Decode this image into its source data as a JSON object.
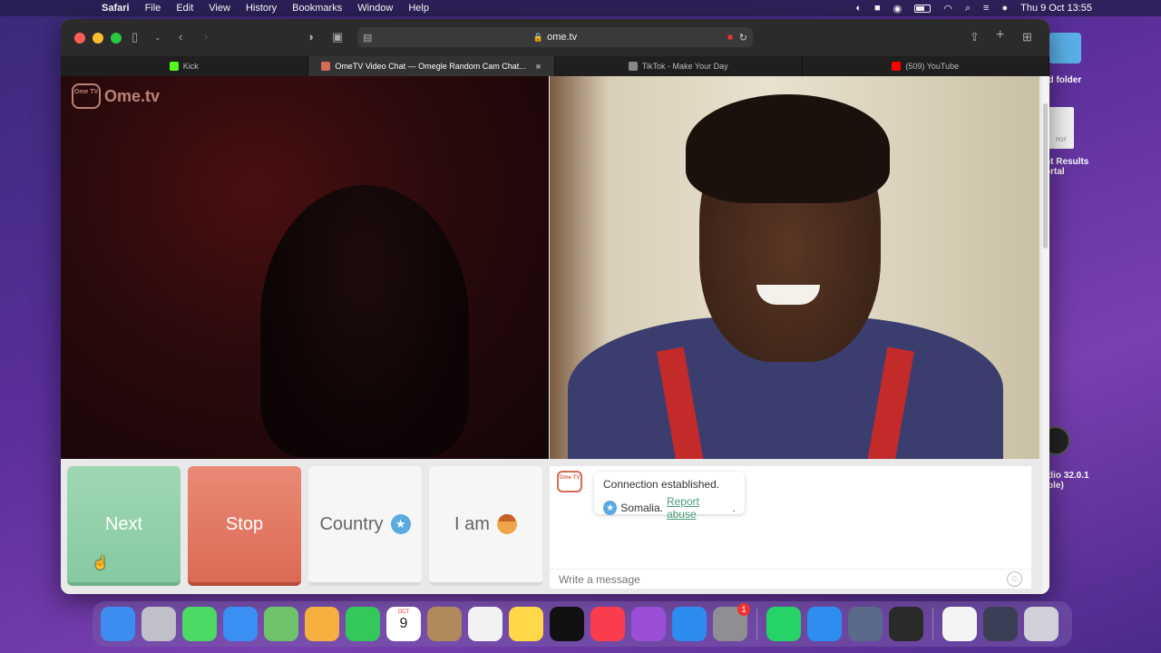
{
  "menubar": {
    "app": "Safari",
    "items": [
      "File",
      "Edit",
      "View",
      "History",
      "Bookmarks",
      "Window",
      "Help"
    ],
    "clock": "Thu 9 Oct  13:55"
  },
  "desktop": {
    "folder_label": "ed folder",
    "pdf_label": "nt Results\nortal",
    "obs_label": "dio 32.0.1\nple)"
  },
  "browser": {
    "url": "ome.tv",
    "tabs": [
      {
        "title": "Kick",
        "color": "#53fc18"
      },
      {
        "title": "OmeTV Video Chat — Omegle Random Cam Chat...",
        "color": "#d36b55"
      },
      {
        "title": "TikTok - Make Your Day",
        "color": "#888888"
      },
      {
        "title": "(509) YouTube",
        "color": "#ff0000"
      }
    ]
  },
  "ometv": {
    "logo_text": "Ome.tv",
    "logo_tv": "Ome TV",
    "buttons": {
      "next": "Next",
      "stop": "Stop",
      "country": "Country",
      "iam": "I am"
    },
    "chat": {
      "line1": "Connection established.",
      "country": "Somalia.",
      "report": "Report abuse",
      "report_suffix": ".",
      "input_placeholder": "Write a message"
    }
  },
  "dock": {
    "calendar_month": "OCT",
    "calendar_day": "9",
    "settings_badge": "1",
    "apps": [
      {
        "name": "finder",
        "color": "#3d8cf0"
      },
      {
        "name": "launchpad",
        "color": "#c0c0c8"
      },
      {
        "name": "messages",
        "color": "#4cd964"
      },
      {
        "name": "mail",
        "color": "#3a8ff5"
      },
      {
        "name": "maps",
        "color": "#6fc36b"
      },
      {
        "name": "photos",
        "color": "#f5b040"
      },
      {
        "name": "facetime",
        "color": "#34c759"
      },
      {
        "name": "calendar",
        "color": "#ffffff"
      },
      {
        "name": "contacts",
        "color": "#b08a5a"
      },
      {
        "name": "reminders",
        "color": "#f2f2f2"
      },
      {
        "name": "notes",
        "color": "#ffd84a"
      },
      {
        "name": "tv",
        "color": "#111111"
      },
      {
        "name": "music",
        "color": "#fa3c4c"
      },
      {
        "name": "podcasts",
        "color": "#9b4ed8"
      },
      {
        "name": "app-store",
        "color": "#2d8cf0"
      },
      {
        "name": "system-settings",
        "color": "#8e8e93"
      },
      {
        "name": "whatsapp",
        "color": "#25d366"
      },
      {
        "name": "safari",
        "color": "#2e8ef0"
      },
      {
        "name": "quicktime",
        "color": "#5a6a8a"
      },
      {
        "name": "obs",
        "color": "#2a2a2a"
      },
      {
        "name": "document",
        "color": "#f4f4f4"
      },
      {
        "name": "screenshot",
        "color": "#3a3f55"
      },
      {
        "name": "trash",
        "color": "#d0d0d8"
      }
    ]
  }
}
